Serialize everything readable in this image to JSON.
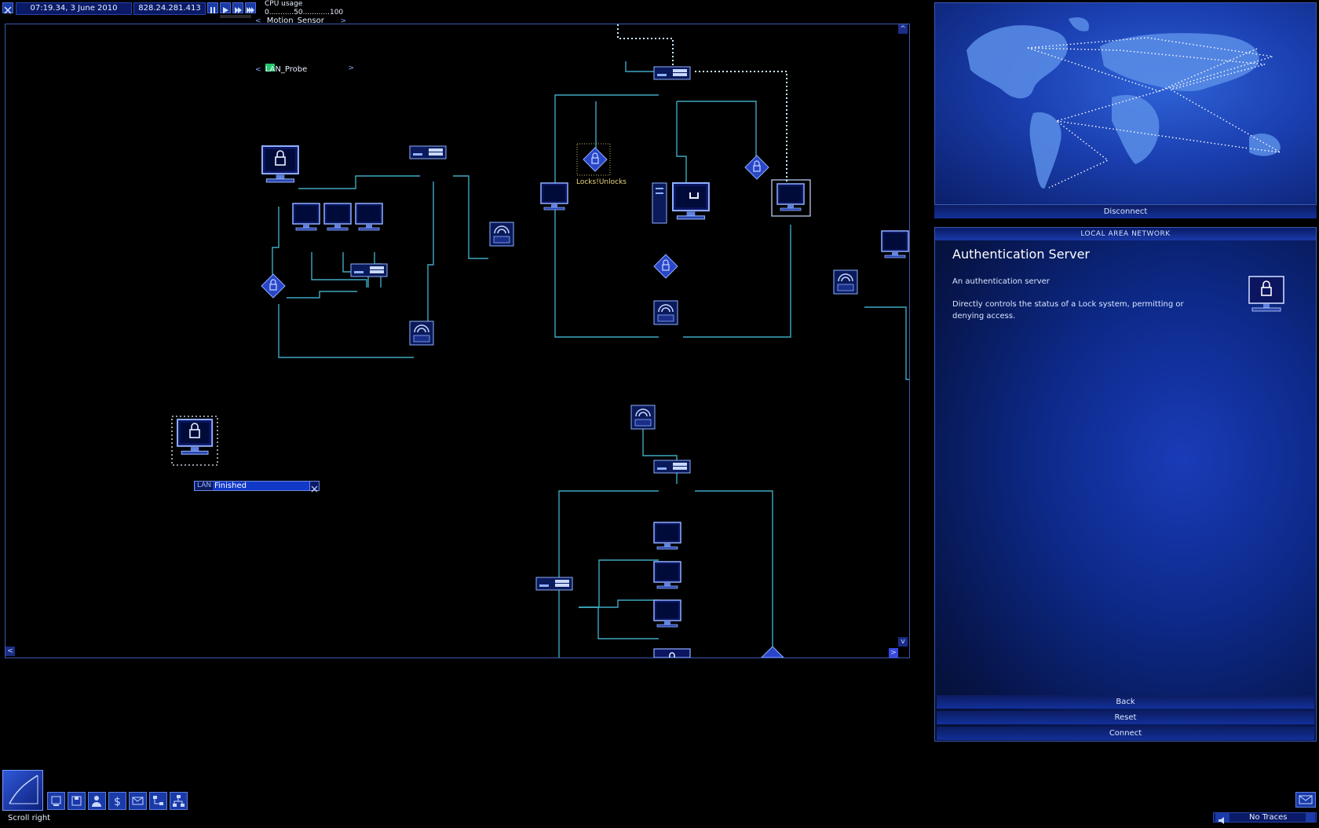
{
  "topbar": {
    "datetime": "07:19.34, 3 June 2010",
    "ip": "828.24.281.413",
    "cpu_label": "CPU usage",
    "cpu_scale": "0...........50............100",
    "tool_selector_1": "Motion_Sensor",
    "tool_selector_2": "LAN_Probe",
    "speed_controls": [
      "pause-icon",
      "play-icon",
      "fast-icon",
      "fastest-icon"
    ]
  },
  "lan": {
    "node_label": "Locks!Unlocks",
    "progress_prefix": "LAN",
    "progress_label": "Finished"
  },
  "right_panel": {
    "disconnect_label": "Disconnect",
    "header": "LOCAL AREA NETWORK",
    "title": "Authentication Server",
    "subtitle": "An authentication server",
    "description": "Directly controls the status of a Lock system, permitting or denying access.",
    "buttons": [
      "Back",
      "Reset",
      "Connect"
    ]
  },
  "statusbar": {
    "hint": "Scroll right",
    "traces": "No Traces"
  },
  "colors": {
    "accent": "#2a4ad8",
    "link": "#3fb4c8",
    "lock": "#3a5ad8",
    "bg": "#000000"
  }
}
